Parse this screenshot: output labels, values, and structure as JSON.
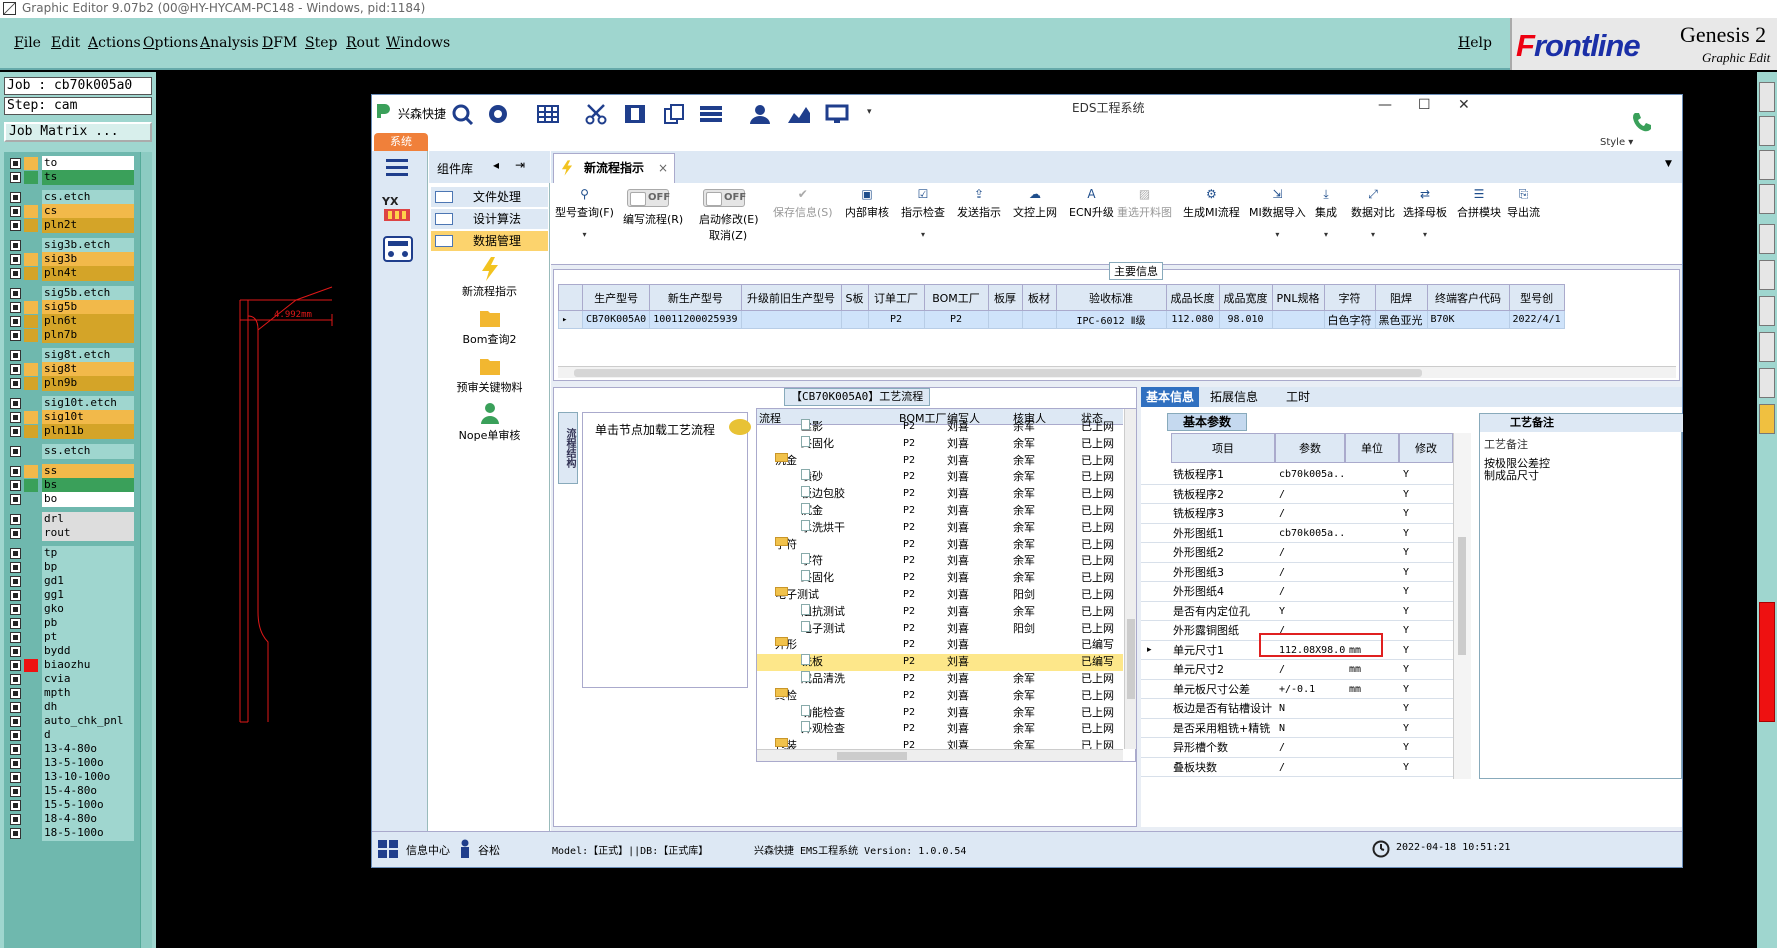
{
  "window": {
    "title": "Graphic Editor 9.07b2 (00@HY-HYCAM-PC148 - Windows, pid:1184)"
  },
  "menu": [
    "File",
    "Edit",
    "Actions",
    "Options",
    "Analysis",
    "DFM",
    "Step",
    "Rout",
    "Windows"
  ],
  "help": "Help",
  "brand": {
    "logo_f": "F",
    "logo_rest": "rontline",
    "product": "Genesis 2",
    "subtitle": "Graphic Edit"
  },
  "job": {
    "job_line": "Job : cb70k005a0",
    "step_line": "Step: cam",
    "matrix_button": "Job Matrix ..."
  },
  "layers": [
    {
      "name": "to",
      "color": "#ffffff",
      "swatch": "#f2b94a"
    },
    {
      "name": "ts",
      "color": "#3aa05a",
      "swatch": "#3aa05a"
    },
    {
      "name": "cs.etch",
      "color": "#9fd6cf",
      "swatch": ""
    },
    {
      "name": "cs",
      "color": "#f2b94a",
      "swatch": "#f2b94a"
    },
    {
      "name": "pln2t",
      "color": "#d4a428",
      "swatch": "#d4a428"
    },
    {
      "name": "sig3b.etch",
      "color": "#9fd6cf",
      "swatch": ""
    },
    {
      "name": "sig3b",
      "color": "#f2b94a",
      "swatch": "#f2b94a"
    },
    {
      "name": "pln4t",
      "color": "#d4a428",
      "swatch": "#d4a428"
    },
    {
      "name": "sig5b.etch",
      "color": "#9fd6cf",
      "swatch": ""
    },
    {
      "name": "sig5b",
      "color": "#f2b94a",
      "swatch": "#f2b94a"
    },
    {
      "name": "pln6t",
      "color": "#d4a428",
      "swatch": "#d4a428"
    },
    {
      "name": "pln7b",
      "color": "#d4a428",
      "swatch": "#d4a428"
    },
    {
      "name": "sig8t.etch",
      "color": "#9fd6cf",
      "swatch": ""
    },
    {
      "name": "sig8t",
      "color": "#f2b94a",
      "swatch": "#f2b94a"
    },
    {
      "name": "pln9b",
      "color": "#d4a428",
      "swatch": "#d4a428"
    },
    {
      "name": "sig10t.etch",
      "color": "#9fd6cf",
      "swatch": ""
    },
    {
      "name": "sig10t",
      "color": "#f2b94a",
      "swatch": "#f2b94a"
    },
    {
      "name": "pln11b",
      "color": "#d4a428",
      "swatch": "#d4a428"
    },
    {
      "name": "ss.etch",
      "color": "#9fd6cf",
      "swatch": ""
    },
    {
      "name": "ss",
      "color": "#f2b94a",
      "swatch": "#f2b94a"
    },
    {
      "name": "bs",
      "color": "#3aa05a",
      "swatch": "#3aa05a"
    },
    {
      "name": "bo",
      "color": "#ffffff",
      "swatch": ""
    },
    {
      "name": "drl",
      "color": "#dddddd",
      "swatch": ""
    },
    {
      "name": "rout",
      "color": "#dddddd",
      "swatch": ""
    },
    {
      "name": "tp",
      "color": "#9fd6cf",
      "swatch": ""
    },
    {
      "name": "bp",
      "color": "#9fd6cf",
      "swatch": ""
    },
    {
      "name": "gd1",
      "color": "#9fd6cf",
      "swatch": ""
    },
    {
      "name": "gg1",
      "color": "#9fd6cf",
      "swatch": ""
    },
    {
      "name": "gko",
      "color": "#9fd6cf",
      "swatch": ""
    },
    {
      "name": "pb",
      "color": "#9fd6cf",
      "swatch": ""
    },
    {
      "name": "pt",
      "color": "#9fd6cf",
      "swatch": ""
    },
    {
      "name": "bydd",
      "color": "#9fd6cf",
      "swatch": ""
    },
    {
      "name": "biaozhu",
      "color": "#9fd6cf",
      "swatch": "#ee1111"
    },
    {
      "name": "cvia",
      "color": "#9fd6cf",
      "swatch": ""
    },
    {
      "name": "mpth",
      "color": "#9fd6cf",
      "swatch": ""
    },
    {
      "name": "dh",
      "color": "#9fd6cf",
      "swatch": ""
    },
    {
      "name": "auto_chk_pnl",
      "color": "#9fd6cf",
      "swatch": ""
    },
    {
      "name": "d",
      "color": "#9fd6cf",
      "swatch": ""
    },
    {
      "name": "13-4-80o",
      "color": "#9fd6cf",
      "swatch": ""
    },
    {
      "name": "13-5-100o",
      "color": "#9fd6cf",
      "swatch": ""
    },
    {
      "name": "13-10-100o",
      "color": "#9fd6cf",
      "swatch": ""
    },
    {
      "name": "15-4-80o",
      "color": "#9fd6cf",
      "swatch": ""
    },
    {
      "name": "15-5-100o",
      "color": "#9fd6cf",
      "swatch": ""
    },
    {
      "name": "18-4-80o",
      "color": "#9fd6cf",
      "swatch": ""
    },
    {
      "name": "18-5-100o",
      "color": "#9fd6cf",
      "swatch": ""
    }
  ],
  "pcb": {
    "dimension": "4.992mm"
  },
  "eds": {
    "title": "EDS工程系统",
    "app_name": "兴森快捷",
    "system_tab": "系统",
    "style_label": "Style",
    "comp_lib": "组件库",
    "lib_items": [
      "文件处理",
      "设计算法",
      "数据管理"
    ],
    "tools": [
      "新流程指示",
      "Bom查询2",
      "预审关键物料",
      "Nope单审核"
    ],
    "tab": "新流程指示",
    "ribbon": {
      "type_query": "型号查询(F)",
      "edit_flow": "编写流程(R)",
      "start_modify": "启动修改(E)",
      "cancel": "取消(Z)",
      "toggle_off": "OFF",
      "save_info": "保存信息(S)",
      "buttons": [
        "内部审核",
        "指示检查",
        "发送指示",
        "文控上网",
        "ECN升级",
        "重选开料图",
        "生成MI流程",
        "MI数据导入",
        "集成",
        "数据对比",
        "选择母板",
        "合拼模块",
        "导出流"
      ]
    },
    "main_info": {
      "title": "主要信息",
      "headers": [
        "生产型号",
        "新生产型号",
        "升级前旧生产型号",
        "S板",
        "订单工厂",
        "BOM工厂",
        "板厚",
        "板材",
        "验收标准",
        "成品长度",
        "成品宽度",
        "PNL规格",
        "字符",
        "阻焊",
        "终端客户代码",
        "型号创"
      ],
      "row": [
        "CB70K005A0",
        "10011200025939",
        "",
        "",
        "P2",
        "P2",
        "",
        "",
        "IPC-6012 Ⅱ级",
        "112.080",
        "98.010",
        "",
        "白色字符",
        "黑色亚光",
        "B70K",
        "2022/4/1"
      ]
    },
    "process": {
      "title": "【CB70K005A0】工艺流程",
      "vert_tab": "流程结构",
      "load_hint": "单击节点加载工艺流程",
      "headers": [
        "流程",
        "BOM工厂",
        "编写人",
        "核审人",
        "状态"
      ],
      "rows": [
        {
          "level": 2,
          "type": "file",
          "name": "丝影",
          "bom": "P2",
          "writer": "刘喜",
          "reviewer": "余军",
          "status": "已上网"
        },
        {
          "level": 2,
          "type": "file",
          "name": "终固化",
          "bom": "P2",
          "writer": "刘喜",
          "reviewer": "余军",
          "status": "已上网"
        },
        {
          "level": 1,
          "type": "folder",
          "name": "沉金",
          "bom": "P2",
          "writer": "刘喜",
          "reviewer": "余军",
          "status": "已上网"
        },
        {
          "level": 2,
          "type": "file",
          "name": "喷砂",
          "bom": "P2",
          "writer": "刘喜",
          "reviewer": "余军",
          "status": "已上网"
        },
        {
          "level": 2,
          "type": "file",
          "name": "板边包胶",
          "bom": "P2",
          "writer": "刘喜",
          "reviewer": "余军",
          "status": "已上网"
        },
        {
          "level": 2,
          "type": "file",
          "name": "沉金",
          "bom": "P2",
          "writer": "刘喜",
          "reviewer": "余军",
          "status": "已上网"
        },
        {
          "level": 2,
          "type": "file",
          "name": "水洗烘干",
          "bom": "P2",
          "writer": "刘喜",
          "reviewer": "余军",
          "status": "已上网"
        },
        {
          "level": 1,
          "type": "folder",
          "name": "字符",
          "bom": "P2",
          "writer": "刘喜",
          "reviewer": "余军",
          "status": "已上网"
        },
        {
          "level": 2,
          "type": "file",
          "name": "字符",
          "bom": "P2",
          "writer": "刘喜",
          "reviewer": "余军",
          "status": "已上网"
        },
        {
          "level": 2,
          "type": "file",
          "name": "终固化",
          "bom": "P2",
          "writer": "刘喜",
          "reviewer": "余军",
          "status": "已上网"
        },
        {
          "level": 1,
          "type": "folder",
          "name": "电子测试",
          "bom": "P2",
          "writer": "刘喜",
          "reviewer": "阳剑",
          "status": "已上网"
        },
        {
          "level": 2,
          "type": "file",
          "name": "阻抗测试",
          "bom": "P2",
          "writer": "刘喜",
          "reviewer": "余军",
          "status": "已上网"
        },
        {
          "level": 2,
          "type": "file",
          "name": "电子测试",
          "bom": "P2",
          "writer": "刘喜",
          "reviewer": "阳剑",
          "status": "已上网"
        },
        {
          "level": 1,
          "type": "folder",
          "name": "外形",
          "bom": "P2",
          "writer": "刘喜",
          "reviewer": "",
          "status": "已编写"
        },
        {
          "level": 2,
          "type": "file",
          "name": "铣板",
          "bom": "P2",
          "writer": "刘喜",
          "reviewer": "",
          "status": "已编写",
          "selected": true
        },
        {
          "level": 2,
          "type": "file",
          "name": "成品清洗",
          "bom": "P2",
          "writer": "刘喜",
          "reviewer": "余军",
          "status": "已上网"
        },
        {
          "level": 1,
          "type": "folder",
          "name": "终检",
          "bom": "P2",
          "writer": "刘喜",
          "reviewer": "余军",
          "status": "已上网"
        },
        {
          "level": 2,
          "type": "file",
          "name": "功能检查",
          "bom": "P2",
          "writer": "刘喜",
          "reviewer": "余军",
          "status": "已上网"
        },
        {
          "level": 2,
          "type": "file",
          "name": "外观检查",
          "bom": "P2",
          "writer": "刘喜",
          "reviewer": "余军",
          "status": "已上网"
        },
        {
          "level": 1,
          "type": "folder",
          "name": "包装",
          "bom": "P2",
          "writer": "刘喜",
          "reviewer": "余军",
          "status": "已上网"
        }
      ]
    },
    "info_tabs": [
      "基本信息",
      "拓展信息",
      "工时"
    ],
    "basic_params": {
      "title": "基本参数",
      "headers": [
        "项目",
        "参数",
        "单位",
        "修改"
      ],
      "rows": [
        {
          "item": "铣板程序1",
          "param": "cb70k005a...",
          "unit": "",
          "mod": "Y"
        },
        {
          "item": "铣板程序2",
          "param": "/",
          "unit": "",
          "mod": "Y"
        },
        {
          "item": "铣板程序3",
          "param": "/",
          "unit": "",
          "mod": "Y"
        },
        {
          "item": "外形图纸1",
          "param": "cb70k005a...",
          "unit": "",
          "mod": "Y"
        },
        {
          "item": "外形图纸2",
          "param": "/",
          "unit": "",
          "mod": "Y"
        },
        {
          "item": "外形图纸3",
          "param": "/",
          "unit": "",
          "mod": "Y"
        },
        {
          "item": "外形图纸4",
          "param": "/",
          "unit": "",
          "mod": "Y"
        },
        {
          "item": "是否有内定位孔",
          "param": "Y",
          "unit": "",
          "mod": "Y"
        },
        {
          "item": "外形露铜图纸",
          "param": "/",
          "unit": "",
          "mod": "Y"
        },
        {
          "item": "单元尺寸1",
          "param": "112.08X98.01",
          "unit": "mm",
          "mod": "Y",
          "current": true
        },
        {
          "item": "单元尺寸2",
          "param": "/",
          "unit": "mm",
          "mod": "Y"
        },
        {
          "item": "单元板尺寸公差",
          "param": "+/-0.1",
          "unit": "mm",
          "mod": "Y"
        },
        {
          "item": "板边是否有钻槽设计",
          "param": "N",
          "unit": "",
          "mod": "Y"
        },
        {
          "item": "是否采用粗铣+精铣",
          "param": "N",
          "unit": "",
          "mod": "Y"
        },
        {
          "item": "异形槽个数",
          "param": "/",
          "unit": "",
          "mod": "Y"
        },
        {
          "item": "叠板块数",
          "param": "/",
          "unit": "",
          "mod": "Y"
        }
      ]
    },
    "remarks": {
      "title": "工艺备注",
      "label": "工艺备注",
      "text": "按极限公差控制成品尺寸"
    },
    "status": {
      "info_center": "信息中心",
      "user": "谷松",
      "model": "Model:【正式】||DB:【正式库】",
      "version": "兴森快捷 EMS工程系统 Version: 1.0.0.54",
      "datetime": "2022-04-18 10:51:21"
    }
  }
}
